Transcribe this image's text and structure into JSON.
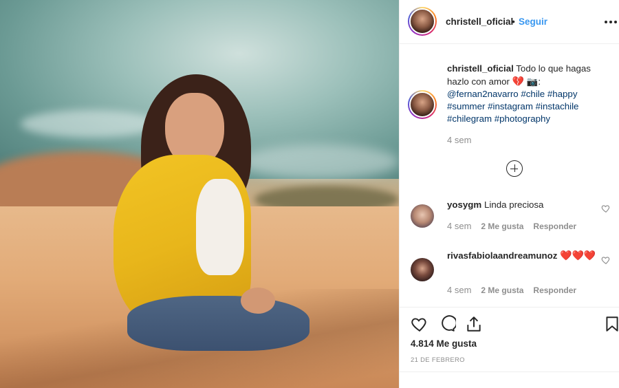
{
  "post": {
    "username": "christell_oficial",
    "separator": "•",
    "follow_label": "Seguir",
    "more_icon": "more-horizontal-icon"
  },
  "caption": {
    "username": "christell_oficial",
    "text_1": "Todo lo que hagas hazlo con amor",
    "emoji_1": "💔",
    "emoji_2": "📷",
    "text_2": ":",
    "mention": "@fernan2navarro",
    "hashtags": [
      "#chile",
      "#happy",
      "#summer",
      "#instagram",
      "#instachile",
      "#chilegram",
      "#photography"
    ],
    "time": "4 sem"
  },
  "comments": [
    {
      "username": "yosygm",
      "text": "Linda preciosa",
      "time": "4 sem",
      "likes": "2 Me gusta",
      "reply": "Responder"
    },
    {
      "username": "rivasfabiolaandreamunoz",
      "text": "❤️❤️❤️",
      "time": "4 sem",
      "likes": "2 Me gusta",
      "reply": "Responder"
    }
  ],
  "actions": {
    "likes_count": "4.814 Me gusta",
    "date": "21 DE FEBRERO"
  },
  "colors": {
    "link": "#3897f0",
    "hashtag": "#003569",
    "muted": "#8e8e8e"
  }
}
